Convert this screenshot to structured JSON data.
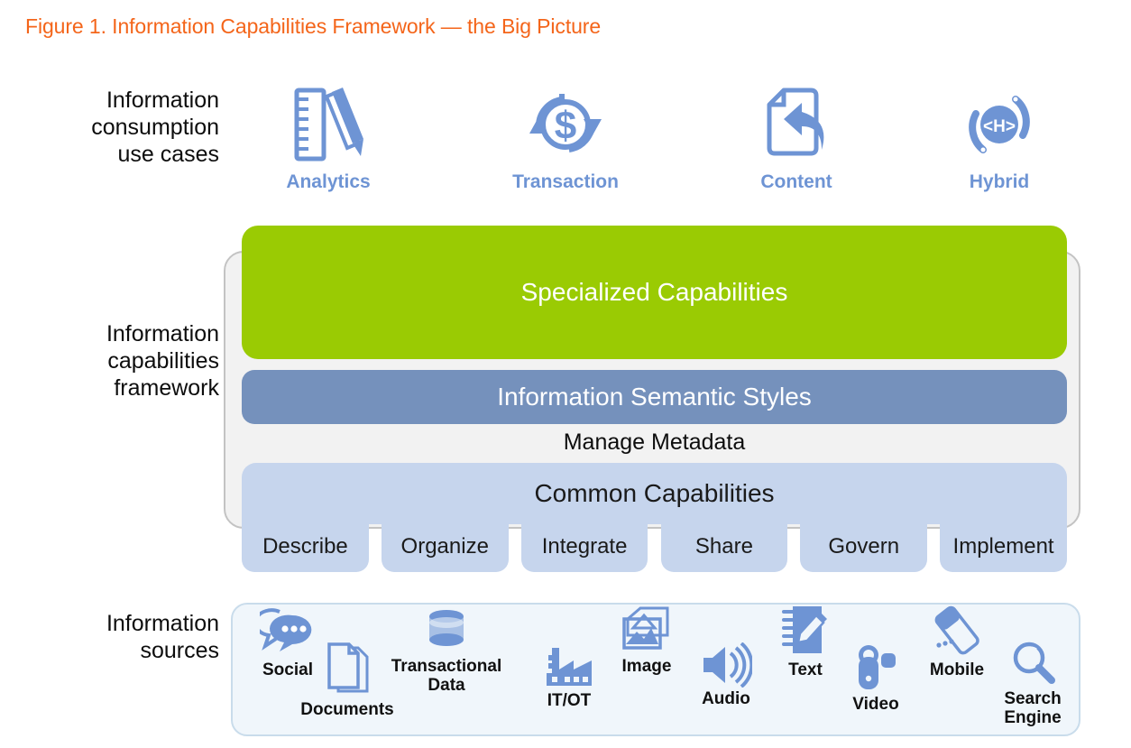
{
  "figure": {
    "title": "Figure 1. Information Capabilities Framework — the Big Picture",
    "title_color": "#F4651A"
  },
  "colors": {
    "specialized_green": "#9ACB03",
    "semantic_slate": "#7591BC",
    "common_light_blue": "#C6D5ED",
    "icon_blue": "#6E94D4",
    "frame_gray": "#F2F2F2",
    "frame_border": "#C3C3C3",
    "sources_bg": "#F0F6FB",
    "sources_border": "#C9DCEB"
  },
  "rows": {
    "consumption_label": "Information\nconsumption\nuse cases",
    "framework_label": "Information\ncapabilities\nframework",
    "sources_label": "Information\nsources"
  },
  "use_cases": [
    {
      "label": "Analytics",
      "icon": "ruler-pencil-icon"
    },
    {
      "label": "Transaction",
      "icon": "dollar-refresh-icon"
    },
    {
      "label": "Content",
      "icon": "document-reply-arrow-icon"
    },
    {
      "label": "Hybrid",
      "icon": "hybrid-orbit-icon"
    }
  ],
  "framework": {
    "specialized": "Specialized Capabilities",
    "semantic_styles": "Information Semantic Styles",
    "manage_metadata": "Manage Metadata",
    "common": "Common Capabilities",
    "capabilities": [
      "Describe",
      "Organize",
      "Integrate",
      "Share",
      "Govern",
      "Implement"
    ]
  },
  "sources": [
    {
      "label": "Social",
      "icon": "speech-bubbles-icon"
    },
    {
      "label": "Documents",
      "icon": "documents-icon"
    },
    {
      "label": "Transactional\nData",
      "icon": "database-cylinder-icon"
    },
    {
      "label": "IT/OT",
      "icon": "factory-icon"
    },
    {
      "label": "Image",
      "icon": "photos-icon"
    },
    {
      "label": "Audio",
      "icon": "speaker-icon"
    },
    {
      "label": "Text",
      "icon": "notebook-pencil-icon"
    },
    {
      "label": "Video",
      "icon": "camcorder-icon"
    },
    {
      "label": "Mobile",
      "icon": "mobile-phone-icon"
    },
    {
      "label": "Search\nEngine",
      "icon": "magnifier-icon"
    }
  ]
}
